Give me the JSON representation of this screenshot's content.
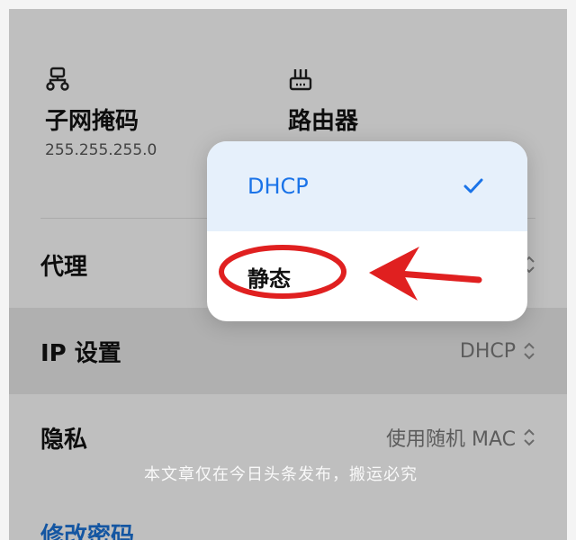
{
  "info": {
    "subnet": {
      "label": "子网掩码",
      "value": "255.255.255.0",
      "icon": "network-icon"
    },
    "router": {
      "label": "路由器",
      "icon": "router-icon"
    }
  },
  "rows": {
    "proxy": {
      "label": "代理"
    },
    "ip_settings": {
      "label": "IP 设置",
      "value": "DHCP"
    },
    "privacy": {
      "label": "隐私",
      "value": "使用随机 MAC"
    }
  },
  "link": {
    "label": "修改密码"
  },
  "dropdown": {
    "options": [
      {
        "label": "DHCP",
        "selected": true
      },
      {
        "label": "静态",
        "selected": false
      }
    ]
  },
  "watermark": "本文章仅在今日头条发布，搬运必究",
  "colors": {
    "accent": "#1a73e8",
    "annotation": "#e02020"
  }
}
